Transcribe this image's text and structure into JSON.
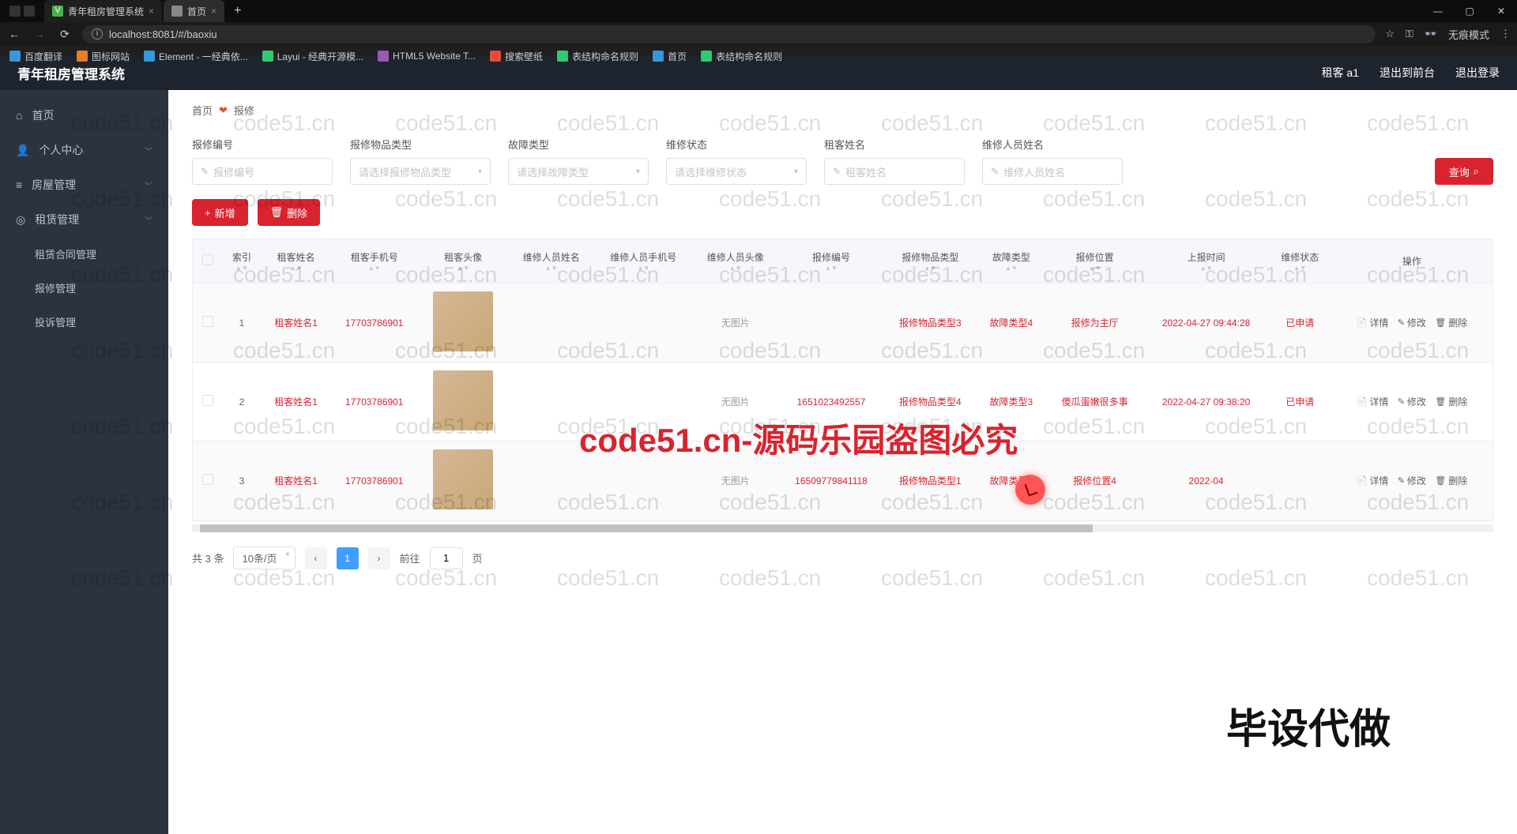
{
  "browser": {
    "tabs": [
      {
        "title": "青年租房管理系统",
        "fav": "V"
      },
      {
        "title": "首页",
        "fav": ""
      }
    ],
    "url": "localhost:8081/#/baoxiu",
    "incognito": "无痕模式",
    "bookmarks": [
      "百度翻译",
      "图标网站",
      "Element - 一经典依...",
      "Layui - 经典开源模...",
      "HTML5 Website T...",
      "搜索壁纸",
      "表结构命名规则",
      "首页",
      "表结构命名规则"
    ]
  },
  "app": {
    "title": "青年租房管理系统",
    "user": "租客 a1",
    "back": "退出到前台",
    "logout": "退出登录"
  },
  "sidebar": {
    "items": [
      {
        "icon": "⌂",
        "label": "首页"
      },
      {
        "icon": "👤",
        "label": "个人中心",
        "chev": true
      },
      {
        "icon": "≡",
        "label": "房屋管理",
        "chev": true
      },
      {
        "icon": "◎",
        "label": "租赁管理",
        "chev": true,
        "open": true
      }
    ],
    "subs": [
      "租赁合同管理",
      "报修管理",
      "投诉管理"
    ]
  },
  "crumb": {
    "home": "首页",
    "sep": "❤",
    "current": "报修"
  },
  "filters": {
    "f1": {
      "label": "报修编号",
      "ph": "报修编号"
    },
    "f2": {
      "label": "报修物品类型",
      "ph": "请选择报修物品类型"
    },
    "f3": {
      "label": "故障类型",
      "ph": "请选择故障类型"
    },
    "f4": {
      "label": "维修状态",
      "ph": "请选择维修状态"
    },
    "f5": {
      "label": "租客姓名",
      "ph": "租客姓名"
    },
    "f6": {
      "label": "维修人员姓名",
      "ph": "维修人员姓名"
    },
    "search": "查询"
  },
  "actions": {
    "add": "新增",
    "del": "删除"
  },
  "table": {
    "headers": [
      "",
      "索引",
      "租客姓名",
      "租客手机号",
      "租客头像",
      "维修人员姓名",
      "维修人员手机号",
      "维修人员头像",
      "报修编号",
      "报修物品类型",
      "故障类型",
      "报修位置",
      "上报时间",
      "维修状态",
      "操作"
    ],
    "rows": [
      {
        "idx": "1",
        "name": "租客姓名1",
        "phone": "17703786901",
        "avatar": true,
        "wname": "",
        "wphone": "",
        "wavatar": "无图片",
        "code": "",
        "ptype": "报修物品类型3",
        "ftype": "故障类型4",
        "loc": "报修为主厅",
        "time": "2022-04-27 09:44:28",
        "status": "已申请"
      },
      {
        "idx": "2",
        "name": "租客姓名1",
        "phone": "17703786901",
        "avatar": true,
        "wname": "",
        "wphone": "",
        "wavatar": "无图片",
        "code": "1651023492557",
        "ptype": "报修物品类型4",
        "ftype": "故障类型3",
        "loc": "傻瓜蛋嫩很多事",
        "time": "2022-04-27 09:38:20",
        "status": "已申请"
      },
      {
        "idx": "3",
        "name": "租客姓名1",
        "phone": "17703786901",
        "avatar": true,
        "wname": "",
        "wphone": "",
        "wavatar": "无图片",
        "code": "16509779841118",
        "ptype": "报修物品类型1",
        "ftype": "故障类型4",
        "loc": "报修位置4",
        "time": "2022-04",
        "status": ""
      }
    ],
    "rowbtns": {
      "detail": "详情",
      "edit": "修改",
      "del": "删除"
    }
  },
  "pager": {
    "total": "共 3 条",
    "size": "10条/页",
    "cur": "1",
    "goto": "前往",
    "gotoval": "1",
    "page_suffix": "页"
  },
  "overlay": {
    "wm_text": "code51.cn",
    "big_text": "code51.cn-源码乐园盗图必究",
    "bottom_text": "毕设代做"
  }
}
